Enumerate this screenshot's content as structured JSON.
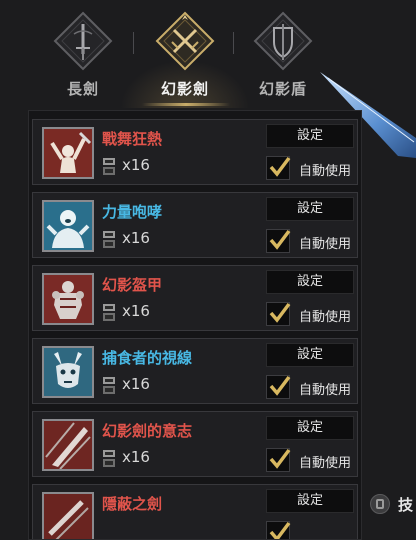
{
  "tabs": [
    {
      "label": "長劍",
      "icon": "long-sword-icon",
      "active": false
    },
    {
      "label": "幻影劍",
      "icon": "phantom-sword-icon",
      "active": true
    },
    {
      "label": "幻影盾",
      "icon": "phantom-shield-icon",
      "active": false
    }
  ],
  "colors": {
    "background": "#1c1c1e",
    "row": "#1f1f22",
    "accent_gold": "#c9ad6a",
    "name_red": "#e0544b",
    "name_blue": "#48b8e4"
  },
  "skills": [
    {
      "name": "戰舞狂熱",
      "name_color": "red",
      "count": "x16",
      "setting_label": "設定",
      "auto_label": "自動使用",
      "auto_checked": true,
      "icon": "berserker-icon"
    },
    {
      "name": "力量咆哮",
      "name_color": "blue",
      "count": "x16",
      "setting_label": "設定",
      "auto_label": "自動使用",
      "auto_checked": true,
      "icon": "roaring-man-icon"
    },
    {
      "name": "幻影盔甲",
      "name_color": "red",
      "count": "x16",
      "setting_label": "設定",
      "auto_label": "自動使用",
      "auto_checked": true,
      "icon": "armor-icon"
    },
    {
      "name": "捕食者的視線",
      "name_color": "blue",
      "count": "x16",
      "setting_label": "設定",
      "auto_label": "自動使用",
      "auto_checked": true,
      "icon": "predator-icon"
    },
    {
      "name": "幻影劍的意志",
      "name_color": "red",
      "count": "x16",
      "setting_label": "設定",
      "auto_label": "自動使用",
      "auto_checked": true,
      "icon": "sword-slash-icon"
    },
    {
      "name": "隱蔽之劍",
      "name_color": "red",
      "count": "",
      "setting_label": "設定",
      "auto_label": "",
      "auto_checked": true,
      "icon": "hidden-sword-icon"
    }
  ],
  "side_hint": {
    "label": "技"
  }
}
